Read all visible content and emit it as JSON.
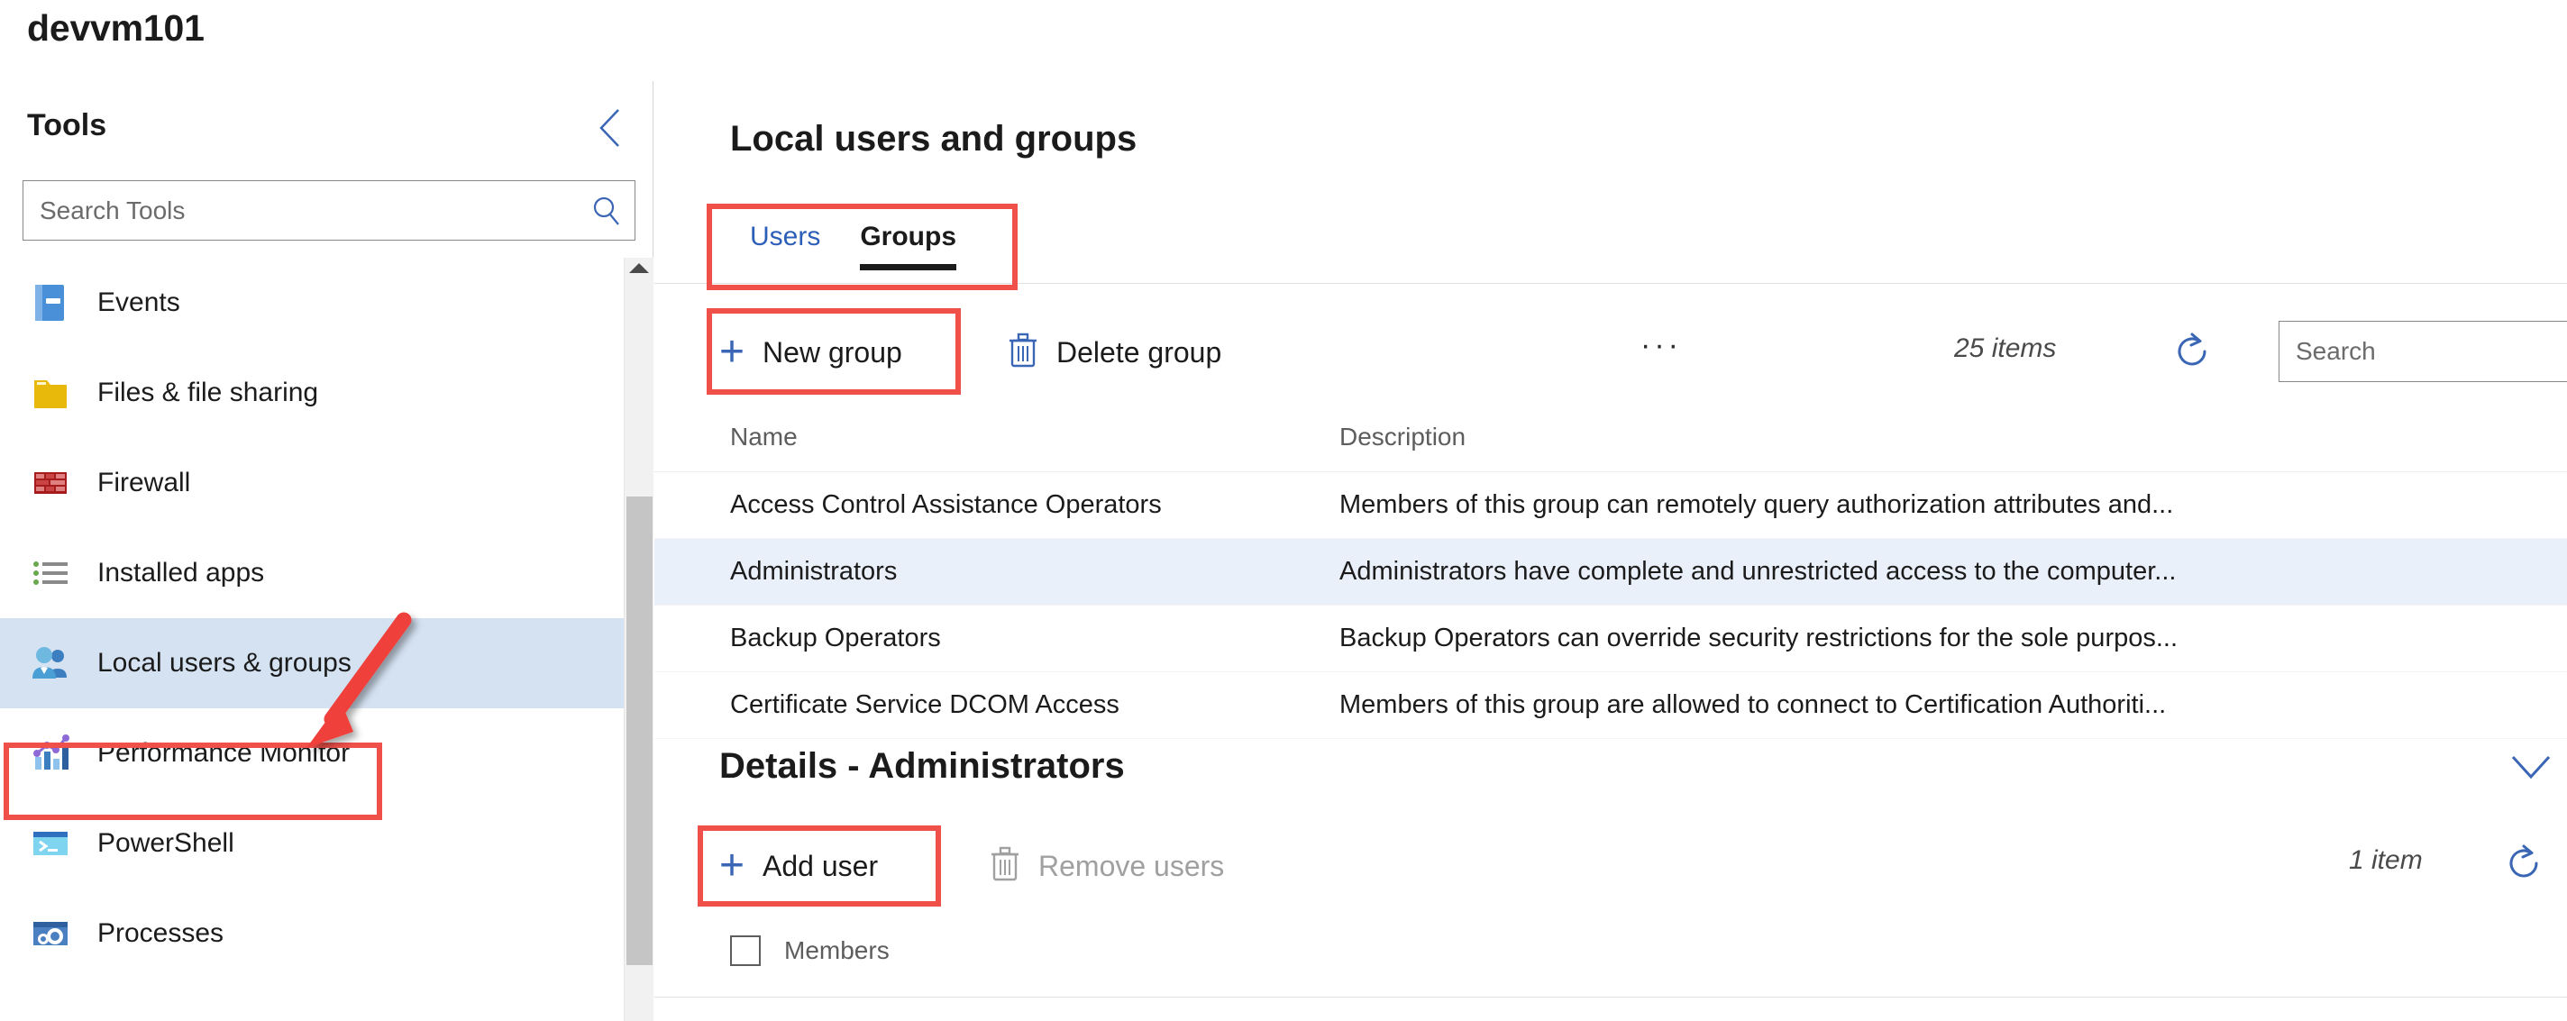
{
  "machine": {
    "name": "devvm101"
  },
  "sidebar": {
    "title": "Tools",
    "collapse_icon": "chevron-left-icon",
    "search": {
      "placeholder": "Search Tools",
      "value": "",
      "icon": "search-icon"
    },
    "items": [
      {
        "label": "Events",
        "icon": "events-icon",
        "selected": false
      },
      {
        "label": "Files & file sharing",
        "icon": "folder-icon",
        "selected": false
      },
      {
        "label": "Firewall",
        "icon": "firewall-brick-icon",
        "selected": false
      },
      {
        "label": "Installed apps",
        "icon": "list-icon",
        "selected": false
      },
      {
        "label": "Local users & groups",
        "icon": "users-icon",
        "selected": true
      },
      {
        "label": "Performance Monitor",
        "icon": "chart-icon",
        "selected": false
      },
      {
        "label": "PowerShell",
        "icon": "terminal-icon",
        "selected": false
      },
      {
        "label": "Processes",
        "icon": "gears-window-icon",
        "selected": false
      }
    ]
  },
  "main": {
    "title": "Local users and groups",
    "tabs": [
      {
        "label": "Users",
        "active": false
      },
      {
        "label": "Groups",
        "active": true
      }
    ],
    "toolbar": {
      "new_group_label": "New group",
      "new_group_icon": "plus-icon",
      "delete_group_label": "Delete group",
      "delete_group_icon": "trash-icon",
      "overflow_label": "···",
      "items_count": "25 items",
      "refresh_icon": "refresh-icon",
      "search": {
        "placeholder": "Search",
        "value": "",
        "icon": "search-icon"
      }
    },
    "table": {
      "columns": [
        "Name",
        "Description"
      ],
      "rows": [
        {
          "name": "Access Control Assistance Operators",
          "description": "Members of this group can remotely query authorization attributes and...",
          "selected": false
        },
        {
          "name": "Administrators",
          "description": "Administrators have complete and unrestricted access to the computer...",
          "selected": true
        },
        {
          "name": "Backup Operators",
          "description": "Backup Operators can override security restrictions for the sole purpos...",
          "selected": false
        },
        {
          "name": "Certificate Service DCOM Access",
          "description": "Members of this group are allowed to connect to Certification Authoriti...",
          "selected": false
        }
      ]
    },
    "details": {
      "title": "Details - Administrators",
      "collapse_icon": "chevron-down-icon",
      "add_user_label": "Add user",
      "add_user_icon": "plus-icon",
      "remove_users_label": "Remove users",
      "remove_users_icon": "trash-icon",
      "items_count": "1 item",
      "refresh_icon": "refresh-icon",
      "members_column": "Members"
    }
  },
  "annotations": {
    "accent_color": "#f0504a",
    "arrow": "red-arrow-pointer",
    "highlight_boxes": [
      "sidebar-local-users-groups",
      "tabs-users-groups",
      "new-group-button",
      "add-user-button"
    ]
  }
}
